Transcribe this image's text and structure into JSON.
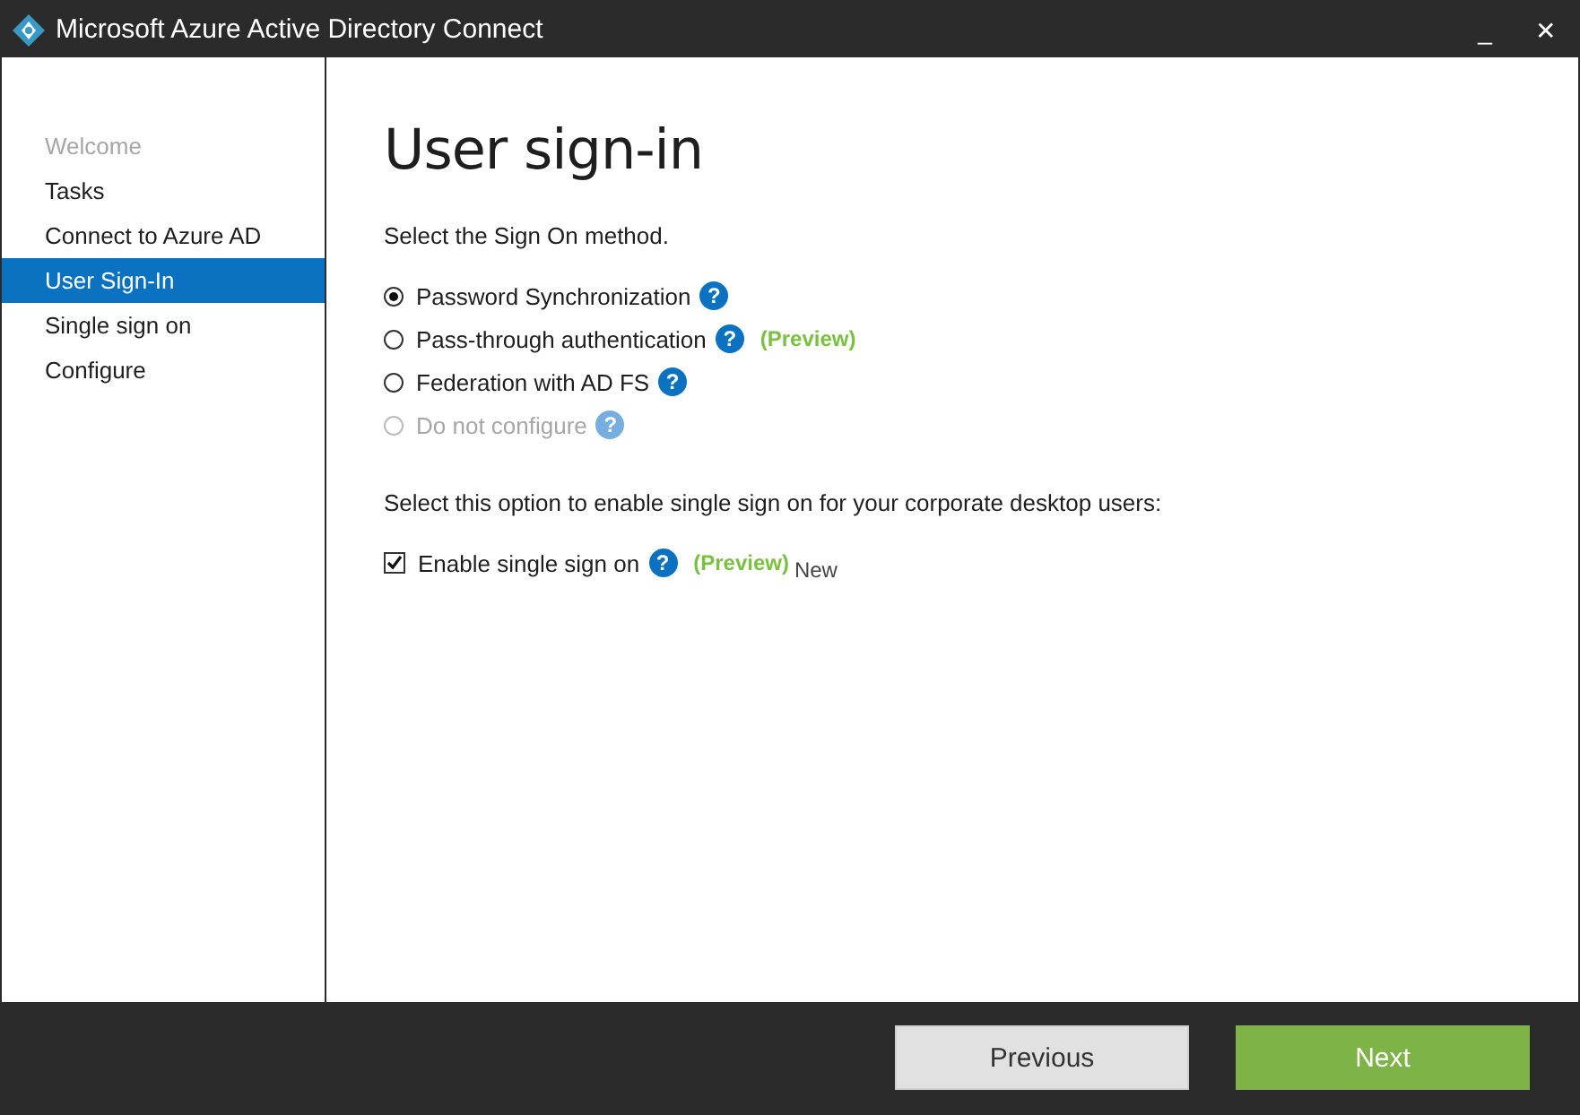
{
  "window": {
    "title": "Microsoft Azure Active Directory Connect",
    "controls": [
      "_",
      "✕"
    ]
  },
  "sidebar": {
    "items": [
      {
        "label": "Welcome",
        "disabled": true,
        "selected": false
      },
      {
        "label": "Tasks",
        "disabled": false,
        "selected": false
      },
      {
        "label": "Connect to Azure AD",
        "disabled": false,
        "selected": false
      },
      {
        "label": "User Sign-In",
        "disabled": false,
        "selected": true
      },
      {
        "label": "Single sign on",
        "disabled": false,
        "selected": false
      },
      {
        "label": "Configure",
        "disabled": false,
        "selected": false
      }
    ]
  },
  "page": {
    "heading": "User sign-in",
    "prompt": "Select the Sign On method.",
    "options": [
      {
        "label": "Password Synchronization",
        "help": "?",
        "selected": true,
        "disabled": false
      },
      {
        "label": "Pass-through authentication",
        "help": "?",
        "badge": "(Preview)",
        "selected": false,
        "disabled": false
      },
      {
        "label": "Federation with AD FS",
        "help": "?",
        "selected": false,
        "disabled": false
      },
      {
        "label": "Do not configure",
        "help": "?",
        "selected": false,
        "disabled": true
      }
    ],
    "sso_prompt": "Select this option to enable single sign on for your corporate desktop users:",
    "sso": {
      "label": "Enable single sign on",
      "help": "?",
      "badge": "(Preview)",
      "note": "New",
      "checked": true
    }
  },
  "buttons": [
    {
      "label": "Previous",
      "kind": "secondary"
    },
    {
      "label": "Next",
      "kind": "primary"
    }
  ]
}
